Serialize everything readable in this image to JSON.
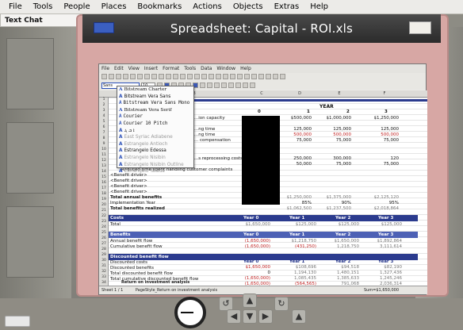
{
  "menubar": {
    "items": [
      "File",
      "Tools",
      "People",
      "Places",
      "Bookmarks",
      "Actions",
      "Objects",
      "Extras",
      "Help"
    ]
  },
  "chat_tab": {
    "label": "Text Chat",
    "close": "×"
  },
  "window": {
    "title": "Spreadsheet: Capital - ROI.xls"
  },
  "app": {
    "menu": [
      "File",
      "Edit",
      "View",
      "Insert",
      "Format",
      "Tools",
      "Data",
      "Window",
      "Help"
    ],
    "font_value": "Sans",
    "font_size": "10",
    "columns": [
      "A",
      "B",
      "C",
      "D",
      "E",
      "F"
    ],
    "rows": [
      "1",
      "2",
      "3",
      "4",
      "5",
      "6",
      "7",
      "8",
      "9",
      "10",
      "11",
      "12",
      "13",
      "14",
      "15",
      "16",
      "17",
      "18",
      "19",
      "20",
      "21",
      "22",
      "23",
      "24",
      "25",
      "26",
      "27",
      "28",
      "29",
      "30",
      "31",
      "32",
      "33",
      "34"
    ]
  },
  "dropdown": {
    "items": [
      {
        "label": "Bitstream Charter",
        "style": "serif"
      },
      {
        "label": "Bitstream Vera Sans",
        "style": "sans"
      },
      {
        "label": "Bitstream Vera Sans Mono",
        "style": "mono"
      },
      {
        "label": "Bitstream Vera Serif",
        "style": "serif"
      },
      {
        "label": "Courier",
        "style": "mono"
      },
      {
        "label": "Courier 10 Pitch",
        "style": "mono"
      },
      {
        "label": "ܐ ܒ ܓ",
        "style": "sans"
      },
      {
        "label": "East Syriac Adiabene",
        "style": "muted"
      },
      {
        "label": "Estrangelo Antioch",
        "style": "muted"
      },
      {
        "label": "Estrangelo Edessa",
        "style": "sans"
      },
      {
        "label": "Estrangelo Nisibin",
        "style": "muted"
      },
      {
        "label": "Estrangelo Nisibin Outline",
        "style": "muted"
      },
      {
        "label": "Estrangelo Talada",
        "style": "muted"
      }
    ]
  },
  "sheet": {
    "year_header": "YEAR",
    "year_cols": [
      "0",
      "1",
      "2",
      "3"
    ],
    "capacity_row": {
      "label": "...ion capacity",
      "values": [
        "$500,000",
        "$1,000,000",
        "$1,250,000"
      ]
    },
    "row_values": [
      {
        "label": "...ng time",
        "values": [
          "125,000",
          "125,000",
          "125,000"
        ],
        "red": false
      },
      {
        "label": "...ng time",
        "values": [
          "500,000",
          "500,000",
          "500,000"
        ],
        "red": true
      },
      {
        "label": "... compensation",
        "values": [
          "75,000",
          "75,000",
          "75,000"
        ],
        "red": false
      }
    ],
    "reprocessing": {
      "label": "...s reprocessing costs",
      "values": [
        "250,000",
        "300,000",
        "120"
      ]
    },
    "reduced_time": {
      "label": "Reduced time spent handling customer complaints",
      "values": [
        "50,000",
        "75,000",
        "75,000"
      ]
    },
    "benefit_driver": "<Benefit driver>",
    "total_annual": {
      "label": "Total annual benefits",
      "values": [
        "$1,250,000",
        "$1,375,000",
        "$2,125,120"
      ]
    },
    "impl_year": {
      "label": "Implementation Year",
      "values": [
        "85%",
        "90%",
        "95%"
      ]
    },
    "total_realized": {
      "label": "Total benefits realized",
      "values": [
        "$1,062,500",
        "$1,237,500",
        "$2,018,864"
      ]
    },
    "costs_band": "Costs",
    "costs_year_hdr": [
      "Year 0",
      "Year 1",
      "Year 2",
      "Year 3"
    ],
    "costs_total": {
      "label": "Total",
      "values": [
        "$1,650,000",
        "$125,000",
        "$125,000",
        "$125,000"
      ]
    },
    "benefits_band": "Benefits",
    "benefits_year_hdr": [
      "Year 0",
      "Year 1",
      "Year 2",
      "Year 3"
    ],
    "annual_flow": {
      "label": "Annual benefit flow",
      "values": [
        "(1,650,000)",
        "$1,218,750",
        "$1,650,000",
        "$1,892,864"
      ]
    },
    "cum_flow": {
      "label": "Cumulative benefit flow",
      "values": [
        "(1,650,000)",
        "(431,250)",
        "1,218,750",
        "3,111,614"
      ]
    },
    "discounted_band": "Discounted benefit flow",
    "disc_year_hdr": [
      "Year 0",
      "Year 1",
      "Year 2",
      "Year 3"
    ],
    "disc_costs": {
      "label": "Discounted costs",
      "values": [
        "$1,650,000",
        "$108,696",
        "$94,518",
        "$82,190"
      ]
    },
    "disc_benefits": {
      "label": "Discounted benefits",
      "values": [
        "0",
        "1,194,130",
        "1,480,151",
        "1,327,436"
      ]
    },
    "total_disc_flow": {
      "label": "Total discounted benefit flow",
      "values": [
        "(1,650,000)",
        "1,085,435",
        "1,385,633",
        "1,245,246"
      ]
    },
    "total_cum_disc": {
      "label": "Total cumulative discounted benefit flow",
      "values": [
        "(1,650,000)",
        "(564,565)",
        "791,068",
        "2,036,314"
      ]
    },
    "roi_label": "Return on investment analysis",
    "sheet_tab": "Sheet 1 / 1",
    "page_style": "PageStyle_Return on investment analysis",
    "sum": "Sum=$1,650,000"
  },
  "controls": {
    "rotate_left": "↺",
    "rotate_right": "↻",
    "up": "▲",
    "down": "▼",
    "left": "◀",
    "right": "▶"
  }
}
